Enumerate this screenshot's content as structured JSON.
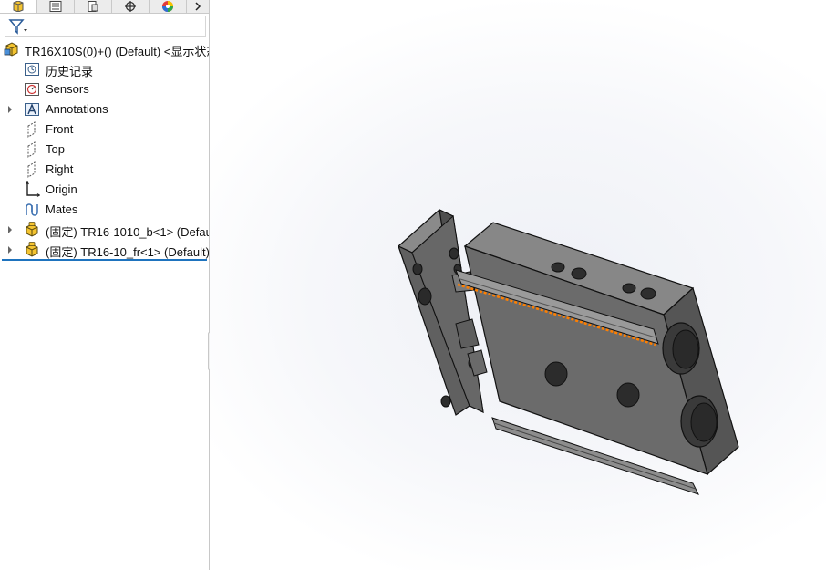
{
  "feature_tree": {
    "root": {
      "label": "TR16X10S(0)+() (Default) <显示状态",
      "icon": "assembly-icon"
    },
    "items": [
      {
        "label": "历史记录",
        "icon": "history-icon",
        "expandable": false
      },
      {
        "label": "Sensors",
        "icon": "sensors-icon",
        "expandable": false
      },
      {
        "label": "Annotations",
        "icon": "annotations-icon",
        "expandable": true
      },
      {
        "label": "Front",
        "icon": "plane-icon",
        "expandable": false
      },
      {
        "label": "Top",
        "icon": "plane-icon",
        "expandable": false
      },
      {
        "label": "Right",
        "icon": "plane-icon",
        "expandable": false
      },
      {
        "label": "Origin",
        "icon": "origin-icon",
        "expandable": false
      },
      {
        "label": "Mates",
        "icon": "mates-icon",
        "expandable": false
      },
      {
        "label": "(固定) TR16-1010_b<1> (Defau",
        "icon": "part-icon",
        "expandable": true
      },
      {
        "label": "(固定) TR16-10_fr<1> (Default)",
        "icon": "part-icon",
        "expandable": true
      }
    ]
  },
  "tabs": [
    "feature-manager-tab",
    "property-manager-tab",
    "configuration-manager-tab",
    "dimxpert-tab",
    "display-manager-tab"
  ],
  "colors": {
    "selection_line": "#1e73be",
    "edge_highlight": "#ff7f00",
    "part_gray": "#6b6b6b"
  }
}
